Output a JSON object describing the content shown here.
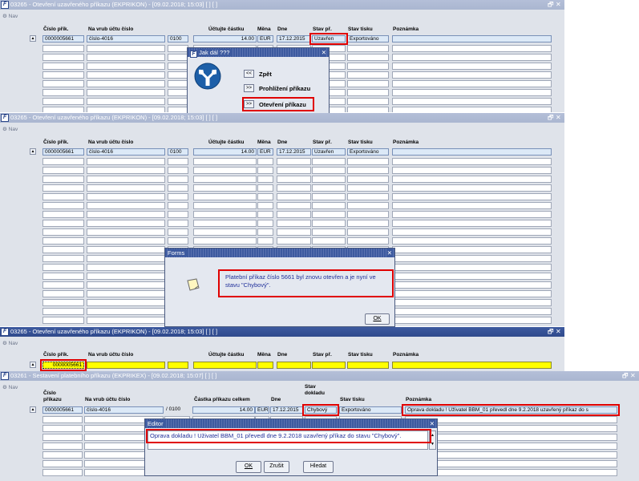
{
  "windows": {
    "w1": {
      "title": "03265 - Otevření uzavřeného příkazu (EKPRIKON) - [09.02.2018; 15:03]  [ ]  [ ]"
    },
    "w2": {
      "title": "03265 - Otevření uzavřeného příkazu (EKPRIKON) - [09.02.2018; 15:03]  [ ]  [ ]"
    },
    "w3": {
      "title": "03265 - Otevření uzavřeného příkazu (EKPRIKON) - [09.02.2018; 15:03]  [ ]  [ ]"
    },
    "w4": {
      "title": "03261 - Sestavení platebního příkazu (EKPRIKEX) - [09.02.2018; 15:07]  [ ]  [ ]"
    }
  },
  "nav_label": "Nav",
  "logo_letter": "F",
  "window_buttons": {
    "restore": "🗗",
    "close": "✕"
  },
  "columns": {
    "cislo": "Číslo přík.",
    "vrub": "Na vrub účtu číslo",
    "castka": "Účtujte částku",
    "mena": "Měna",
    "dne": "Dne",
    "stav": "Stav př.",
    "tisk": "Stav tisku",
    "poznamka": "Poznámka"
  },
  "columns4": {
    "cislo_l1": "Číslo",
    "cislo_l2": "příkazu",
    "vrub": "Na vrub účtu číslo",
    "castka": "Částka příkazu celkem",
    "dne": "Dne",
    "stav_l1": "Stav",
    "stav_l2": "dokladu",
    "tisk": "Stav tisku",
    "poznamka": "Poznámka"
  },
  "row": {
    "cislo": "0000005661",
    "vrub": "číslo-4016",
    "kod": "0100",
    "castka": "14.00",
    "mena": "EUR",
    "dne": "17.12.2015",
    "stav": "Uzavřen",
    "tisk": "Exportováno"
  },
  "row4": {
    "cislo": "0000005661",
    "vrub": "číslo-4016",
    "kod": "/ 0100",
    "castka": "14.00",
    "mena": "EUR",
    "dne": "17.12.2015",
    "stav": "Chybový",
    "tisk": "Exportováno",
    "poznamka": "Oprava dokladu !  Uživatel BBM_01 převedl dne 9.2.2018 uzavřený příkaz do s"
  },
  "row3": {
    "cislo": "0000005661"
  },
  "dialog_jak": {
    "title": "Jak dál ???",
    "back_btn": "<<",
    "back_label": "Zpět",
    "view_btn": ">>",
    "view_label": "Prohlížení příkazu",
    "open_btn": ">>",
    "open_label": "Otevření příkazu"
  },
  "dialog_forms": {
    "title": "Forms",
    "message": "Platební příkaz číslo 5661 byl znovu otevřen a je nyní ve stavu \"Chybový\".",
    "ok": "OK"
  },
  "dialog_editor": {
    "title": "Editor",
    "text": "Oprava dokladu !  Uživatel BBM_01 převedl dne 9.2.2018 uzavřený příkaz do stavu \"Chybový\".",
    "ok": "OK",
    "cancel": "Zrušit",
    "search": "Hledat"
  }
}
